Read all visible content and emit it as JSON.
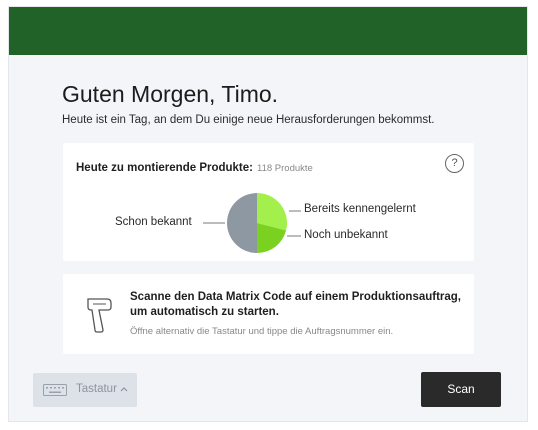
{
  "colors": {
    "header": "#216229",
    "pie_known": "#8e98a3",
    "pie_learned": "#a3ef4b",
    "pie_unknown": "#7ad11f"
  },
  "greeting": {
    "title": "Guten Morgen, Timo.",
    "subtitle": "Heute ist ein Tag, an dem Du einige neue Herausforderungen bekommst."
  },
  "products": {
    "title": "Heute zu montierende Produkte:",
    "count": "118 Produkte",
    "help_icon": "?"
  },
  "chart_data": {
    "type": "pie",
    "categories": [
      "Schon bekannt",
      "Bereits kennengelernt",
      "Noch unbekannt"
    ],
    "values": [
      50,
      29,
      21
    ]
  },
  "scan_card": {
    "title": "Scanne den Data Matrix Code auf einem Produktionsauftrag, um automatisch zu starten.",
    "hint": "Öffne alternativ die Tastatur und tippe die Auftragsnummer ein.",
    "icon": "barcode-scanner-icon"
  },
  "footer": {
    "keyboard_label": "Tastatur",
    "keyboard_icon": "keyboard-icon",
    "scan_label": "Scan"
  }
}
